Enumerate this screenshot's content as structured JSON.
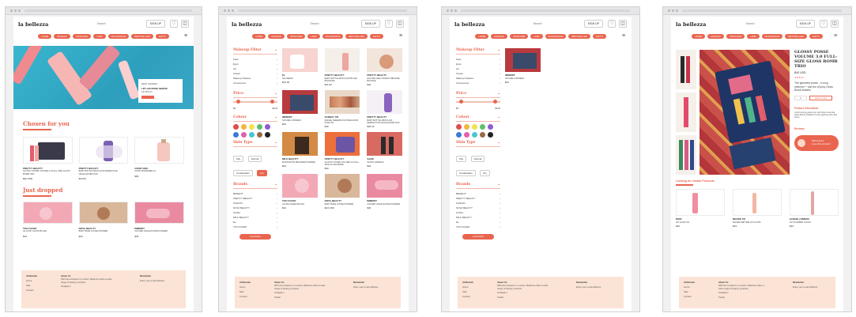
{
  "brand": {
    "logo": "la bellezza",
    "accent": "#e9654f",
    "footer_bg": "#fbe3d6"
  },
  "header": {
    "search_placeholder": "Search",
    "signin": "SIGN UP",
    "icons": [
      "heart-icon",
      "bag-icon"
    ]
  },
  "nav": [
    "HOME",
    "MAKEUP",
    "SKINCARE",
    "HAIR",
    "FRAGRANCE",
    "BESTSELLER",
    "GIFTS",
    "SALE"
  ],
  "screens": {
    "home": {
      "hero": {
        "kicker": "NEW SHADES",
        "title": "LIP LAB ROSE SERUM",
        "subtitle": "LIP BALM"
      },
      "chosen_title": "Chosen for you",
      "chosen": [
        {
          "brand": "PRETTY BEAUTY",
          "name": "GLOSSY POSSE VOLUME 3.0 FULL-SIZE GLOSS BOMB TRIO",
          "price": "$40 USD"
        },
        {
          "brand": "PRETTY BEAUTY",
          "name": "BABY BOTTLE MINI FLUID PERFECTIVE HIGHLIGHTER DUO",
          "price": "$24.00"
        },
        {
          "brand": "GOOD GIRL",
          "name": "GOOD MARSHMELLO",
          "price": "$60"
        }
      ],
      "dropped_title": "Just dropped",
      "dropped": [
        {
          "brand": "TOO FACED",
          "name": "LE LOOK GLOSS BLUSH",
          "price": "$24"
        },
        {
          "brand": "NOVA BEAUTY",
          "name": "BABY BAKE LOOSE POWDER",
          "price": "$24"
        },
        {
          "brand": "IMMERIT",
          "name": "GOLDEN HIGHLIGHTER POWDER",
          "price": "$32"
        }
      ]
    },
    "listing": {
      "filter_makeup": "Makeup Filter",
      "makeup_items": [
        "Face",
        "Eyes",
        "Lip",
        "Cheek",
        "Makeup Palettes",
        "Accessories"
      ],
      "price": {
        "label": "Price",
        "min": "$0",
        "max": "$100"
      },
      "colour": "Colour",
      "skin_label": "Skin Type",
      "skin_tags": [
        "Oily",
        "Normal",
        "Combination",
        "Dry"
      ],
      "brands_label": "Brands",
      "brands": [
        "BENEFIT",
        "PRETTY BEAUTY",
        "SUNDAY",
        "NOVA BEAUTY",
        "GOSH",
        "MILK BEAUTY",
        "EL",
        "TOO FACED"
      ],
      "load_more": "Load More",
      "products": [
        {
          "brand": "EL",
          "name": "SE CREAM",
          "price": "$24.00"
        },
        {
          "brand": "PRETTY BEAUTY",
          "name": "BABY BOTTLE MINI FLUID BLUSH BOUNCER",
          "price": "$21.00"
        },
        {
          "brand": "PRETTY BEAUTY",
          "name": "DUO BULAZE CONFECT BRONZE BOUNCE",
          "price": "$24"
        },
        {
          "brand": "IMMERIT",
          "name": "SATURE LOWNESS",
          "price": "$24"
        },
        {
          "brand": "SUNDAY 7/8",
          "name": "MACHE SHEENDOO EYESHADOW PALETTE",
          "price": "$36"
        },
        {
          "brand": "PRETTY BEAUTY",
          "name": "BABY BOTTLE MINI FLUID PERFECTIVE HIGHLIGHTER DUO",
          "price": "$24.00"
        },
        {
          "brand": "MILK BEAUTY",
          "name": "BLUR MATTE BRONZER POWDER",
          "price": "$24"
        },
        {
          "brand": "PRETTY BEAUTY",
          "name": "GLOSSY POSSE VOLUME 3.0 FULL-SIZE GLOSS BOMB",
          "price": "$40"
        },
        {
          "brand": "SAHR",
          "name": "SATIN LOWNESS",
          "price": "$24"
        },
        {
          "brand": "TOO FACED",
          "name": "GLOSS CHEEK BLUSH",
          "price": "$24"
        },
        {
          "brand": "NOVA BEAUTY",
          "name": "BABY BAKE LOOSE POWDER",
          "price": "$24 USD"
        },
        {
          "brand": "IMMERIT",
          "name": "GOLDEN HIGHLIGHTER POWDER",
          "price": "$32"
        }
      ]
    },
    "filtered": {
      "brands_label": "Brands",
      "product": {
        "brand": "IMMERIT",
        "name": "SATURE LOWNESS",
        "price": "$24"
      }
    },
    "detail": {
      "title": "GLOSSY POSSE VOLUME 3.0 FULL-SIZE GLOSS BOMB TRIO",
      "price": "$40 USD",
      "reviews": "★★★★☆",
      "headline": "The glossiest posse - a cozy, shimmer + lust trio of juicy Gloss Bomb shades",
      "qty": "1",
      "add": "Add to Cart",
      "info_title": "Product Information",
      "info_text": "A shimmering glossy trio with three universal Gloss Bomb shades for easy layering with ultra shine.",
      "reviews_title": "Reviews",
      "chat_name": "Mira Kassa",
      "chat_text": "Love this product!",
      "similar_title": "Looking for similar Products",
      "similar": [
        {
          "brand": "DIOR",
          "name": "LIP GLOW OIL",
          "price": "$40"
        },
        {
          "brand": "RHODE 7/8",
          "name": "RHODE PEPTIDE LIP GLOSS",
          "price": "$24"
        },
        {
          "brand": "GOSHE LONDON",
          "name": "LIP PLUMPER GLOSS",
          "price": "$24"
        }
      ]
    }
  },
  "footer": {
    "col1": [
      "All Brands",
      "Home",
      "Sale",
      "Contact"
    ],
    "col2_title": "About Us",
    "col2_text": "With two locations in London, Bellezza offers a wide range of beauty products.",
    "col2_links": [
      "Instagram",
      "Twitter"
    ],
    "col3_title": "Newsletter",
    "col3_text": "Enter your email address"
  }
}
